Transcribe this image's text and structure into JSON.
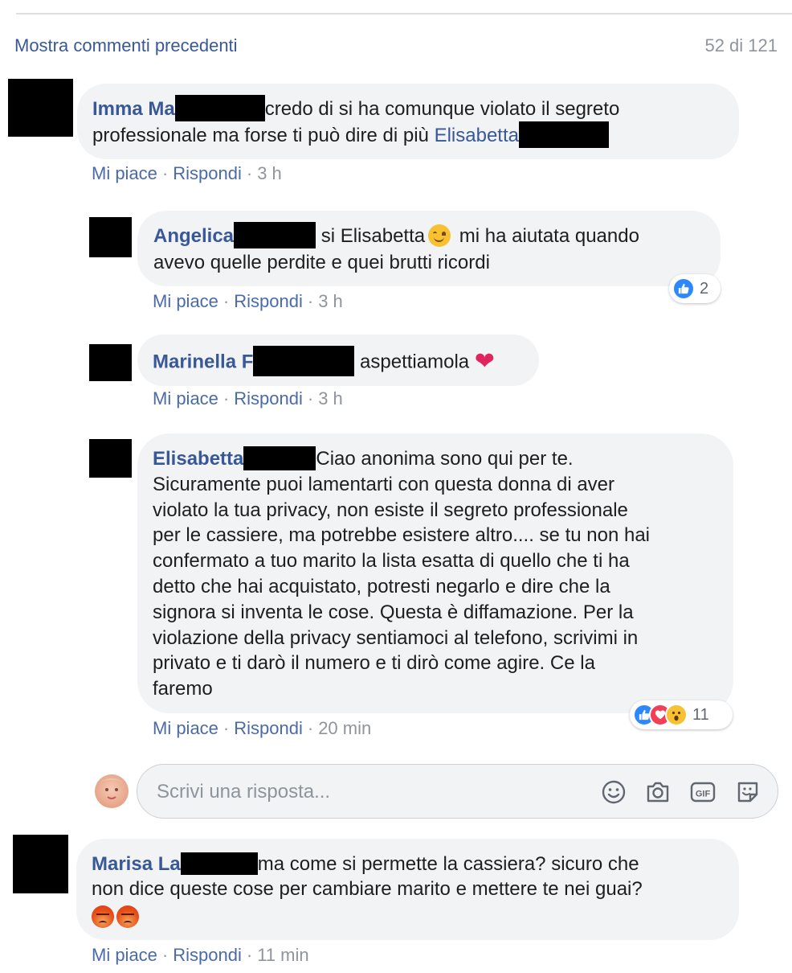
{
  "header": {
    "more_comments": "Mostra commenti precedenti",
    "count": "52 di 121"
  },
  "labels": {
    "like": "Mi piace",
    "reply": "Rispondi",
    "dot": "·"
  },
  "comments": [
    {
      "name": "Imma Ma",
      "text_parts": [
        "credo di si ha comunque violato il segreto",
        "professionale ma forse ti può dire di più"
      ],
      "mention": "Elisabetta",
      "time": "3 h"
    },
    {
      "name": "Angelica",
      "text_parts": [
        "si Elisabetta",
        "mi ha aiutata quando",
        "avevo quelle perdite e quei brutti ricordi"
      ],
      "time": "3 h",
      "reactions": {
        "icons": [
          "like-icon"
        ],
        "count": "2"
      }
    },
    {
      "name": "Marinella F",
      "text": "aspettiamola",
      "time": "3 h"
    },
    {
      "name": "Elisabetta",
      "lines": [
        "Ciao anonima sono qui per te.",
        "Sicuramente puoi lamentarti con questa donna di aver",
        "violato la tua privacy, non esiste il segreto professionale",
        "per le cassiere, ma potrebbe esistere altro.... se tu non hai",
        "confermato a tuo marito la lista esatta di quello che ti ha",
        "detto che hai acquistato, potresti negarlo e dire che la",
        "signora si inventa le cose. Questa è diffamazione. Per la",
        "violazione della privacy sentiamoci al telefono, scrivimi in",
        "privato e ti darò il numero e ti dirò come agire. Ce la",
        "faremo"
      ],
      "time": "20 min",
      "reactions": {
        "icons": [
          "like-icon",
          "love-icon",
          "wow-icon"
        ],
        "count": "11"
      }
    },
    {
      "name": "Marisa La",
      "text_parts": [
        "ma come si permette la cassiera? sicuro che",
        "non dice queste cose per cambiare marito e mettere te nei guai?"
      ],
      "time": "11 min"
    }
  ],
  "reply_box": {
    "placeholder": "Scrivi una risposta...",
    "icons": [
      "emoji-icon",
      "camera-icon",
      "gif-icon",
      "sticker-icon"
    ]
  },
  "colors": {
    "link": "#385898",
    "meta": "#90949c",
    "bubble": "#f2f3f5",
    "like": "#2d88ff",
    "love": "#f33e58"
  }
}
